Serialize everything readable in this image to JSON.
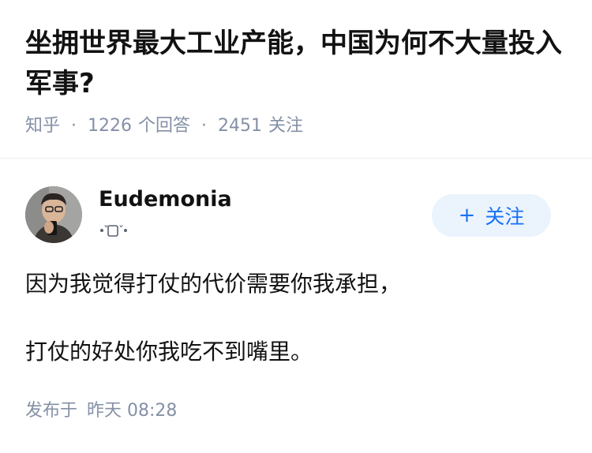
{
  "question": {
    "title": "坐拥世界最大工业产能，中国为何不大量投入军事?",
    "site": "知乎",
    "separator": "·",
    "answer_count": "1226",
    "answer_label": "个回答",
    "follower_count": "2451",
    "follower_label": "关注"
  },
  "answer": {
    "author": {
      "name": "Eudemonia",
      "badge_icon": "emoji-face-icon"
    },
    "follow_button": {
      "plus": "+",
      "label": "关注"
    },
    "paragraphs": [
      "因为我觉得打仗的代价需要你我承担，",
      "打仗的好处你我吃不到嘴里。"
    ],
    "publish_prefix": "发布于",
    "publish_time": "昨天 08:28"
  },
  "colors": {
    "accent": "#1772f6",
    "follow_bg": "#ebf3fd",
    "meta_gray": "#8590a6",
    "text": "#121212"
  }
}
